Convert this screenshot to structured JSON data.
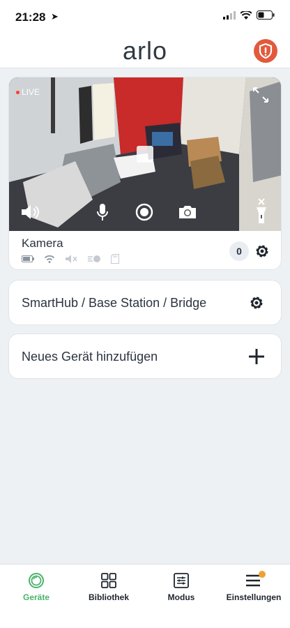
{
  "status_bar": {
    "time": "21:28",
    "location_glyph": "➤"
  },
  "header": {
    "logo": "arlo",
    "alert_icon": "shield-alert-icon"
  },
  "camera_card": {
    "live_label": "LIVE",
    "name": "Kamera",
    "event_count": "0",
    "controls": [
      "speaker-icon",
      "microphone-icon",
      "record-icon",
      "snapshot-icon",
      "spotlight-icon"
    ]
  },
  "rows": [
    {
      "label": "SmartHub / Base Station / Bridge",
      "icon": "gear-icon"
    },
    {
      "label": "Neues Gerät hinzufügen",
      "icon": "plus-icon"
    }
  ],
  "tabs": [
    {
      "label": "Geräte",
      "icon": "devices-icon",
      "active": true
    },
    {
      "label": "Bibliothek",
      "icon": "library-icon",
      "active": false
    },
    {
      "label": "Modus",
      "icon": "mode-icon",
      "active": false
    },
    {
      "label": "Einstellungen",
      "icon": "settings-icon",
      "active": false
    }
  ],
  "colors": {
    "accent_green": "#4bb26b",
    "alert_red": "#e25a3c",
    "badge_orange": "#f0a030"
  }
}
